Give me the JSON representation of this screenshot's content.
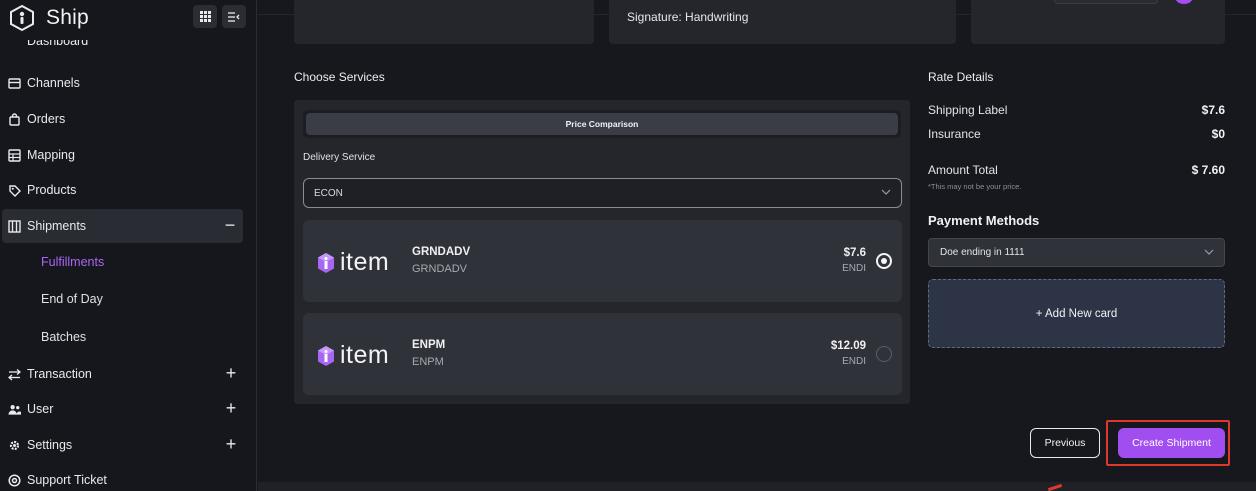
{
  "app": {
    "name": "Ship"
  },
  "sidebar": {
    "partial_top_label": "Dashboard",
    "items": [
      {
        "label": "Channels",
        "icon": "storefront-icon"
      },
      {
        "label": "Orders",
        "icon": "shopping-bag-icon"
      },
      {
        "label": "Mapping",
        "icon": "table-icon"
      },
      {
        "label": "Products",
        "icon": "tag-icon"
      },
      {
        "label": "Shipments",
        "icon": "warehouse-icon",
        "expander": "−"
      },
      {
        "label": "Transaction",
        "icon": "arrows-exchange-icon",
        "expander": "+"
      },
      {
        "label": "User",
        "icon": "users-icon",
        "expander": "+"
      },
      {
        "label": "Settings",
        "icon": "gear-icon",
        "expander": "+"
      },
      {
        "label": "Support Ticket",
        "icon": "help-icon"
      }
    ],
    "sub_items": [
      "Fulfillments",
      "End of Day",
      "Batches"
    ]
  },
  "top": {
    "signature_text": "Signature: Handwriting"
  },
  "services": {
    "title": "Choose Services",
    "tab_label": "Price Comparison",
    "delivery_label": "Delivery Service",
    "delivery_value": "ECON",
    "rates": [
      {
        "logo_text": "item",
        "name": "GRNDADV",
        "sub": "GRNDADV",
        "price": "$7.6",
        "currency": "ENDI",
        "selected": true
      },
      {
        "logo_text": "item",
        "name": "ENPM",
        "sub": "ENPM",
        "price": "$12.09",
        "currency": "ENDI",
        "selected": false
      }
    ]
  },
  "rate_details": {
    "title": "Rate Details",
    "shipping_label": "Shipping Label",
    "shipping_value": "$7.6",
    "insurance_label": "Insurance",
    "insurance_value": "$0",
    "total_label": "Amount Total",
    "total_value": "$ 7.60",
    "note": "*This may not be your price."
  },
  "payment": {
    "title": "Payment Methods",
    "selected": "Doe ending in 1111",
    "add_card": "+ Add New card"
  },
  "actions": {
    "previous": "Previous",
    "create": "Create Shipment"
  },
  "colors": {
    "accent": "#a04ef0",
    "highlight": "#e1372f",
    "active_sub": "#a866f4"
  }
}
